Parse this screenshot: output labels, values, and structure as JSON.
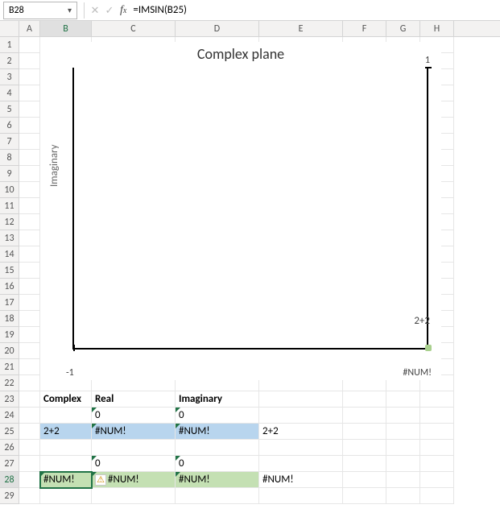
{
  "formula_bar": {
    "namebox": "B28",
    "formula": "=IMSIN(B25)"
  },
  "columns": [
    "A",
    "B",
    "C",
    "D",
    "E",
    "F",
    "G",
    "H"
  ],
  "chart": {
    "title": "Complex plane",
    "y_axis_label": "Imaginary",
    "y_tick_top": "1",
    "x_tick_left": "-1",
    "x_tick_right": "#NUM!",
    "data_point_label": "2+2"
  },
  "table": {
    "headers": {
      "b": "Complex",
      "c": "Real",
      "d": "Imaginary"
    },
    "r24": {
      "c": "0",
      "d": "0"
    },
    "r25": {
      "b": "2+2",
      "c": "#NUM!",
      "d": "#NUM!",
      "e": "2+2"
    },
    "r27": {
      "c": "0",
      "d": "0"
    },
    "r28": {
      "b": "#NUM!",
      "c": "#NUM!",
      "d": "#NUM!",
      "e": "#NUM!"
    }
  },
  "chart_data": {
    "type": "scatter",
    "title": "Complex plane",
    "xlabel": "",
    "ylabel": "Imaginary",
    "x_ticks": [
      "-1",
      "#NUM!"
    ],
    "y_ticks": [
      "1"
    ],
    "series": [
      {
        "name": "2+2",
        "points": [
          {
            "x_label": "#NUM!",
            "y": 1,
            "error": true
          }
        ]
      }
    ],
    "note": "chart axis shows error value #NUM! as x-axis tick; single data marker rendered at plot corner"
  }
}
